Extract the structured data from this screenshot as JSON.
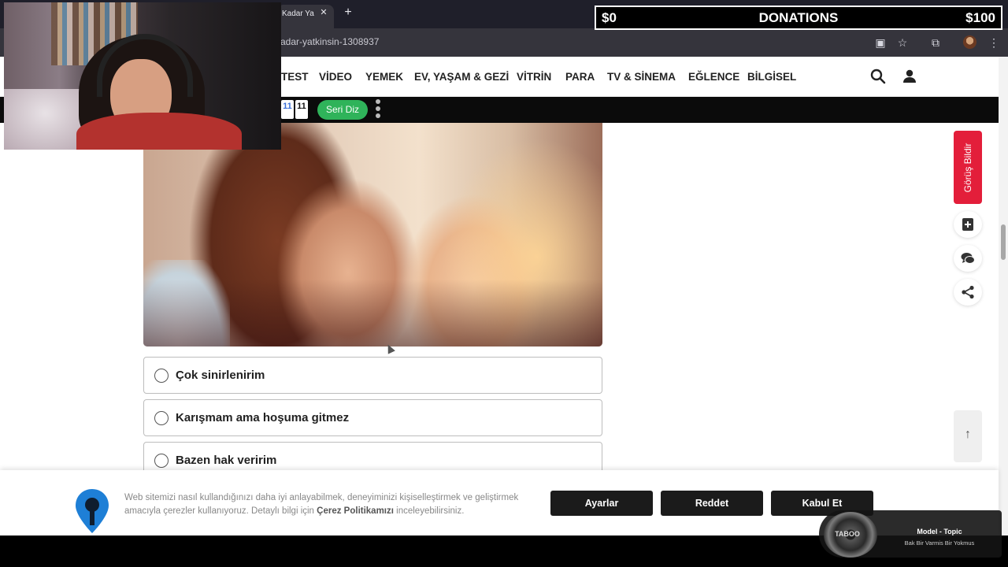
{
  "browser": {
    "tab_title": "Kadar Ya",
    "tab_close": "✕",
    "new_tab": "+",
    "url": "kadar-yatkinsin-1308937"
  },
  "donations": {
    "left": "$0",
    "center": "DONATIONS",
    "right": "$100"
  },
  "nav": {
    "items": [
      "TEST",
      "VİDEO",
      "YEMEK",
      "EV, YAŞAM & GEZİ",
      "VİTRİN",
      "PARA",
      "TV & SİNEMA",
      "EĞLENCE",
      "BİLGİSEL"
    ]
  },
  "toolbar": {
    "tile_1": "11",
    "tile_2": "11",
    "seri_button": "Seri Diz"
  },
  "options": [
    {
      "label": "Çok sinirlenirim"
    },
    {
      "label": "Karışmam ama hoşuma gitmez"
    },
    {
      "label": "Bazen hak veririm"
    }
  ],
  "side": {
    "feedback": "Görüş Bildir",
    "totop": "↑"
  },
  "cookie": {
    "text_before": "Web sitemizi nasıl kullandığınızı daha iyi anlayabilmek, deneyiminizi kişiselleştirmek ve geliştirmek amacıyla çerezler kullanıyoruz. Detaylı bilgi için ",
    "link": "Çerez Politikamızı",
    "text_after": " inceleyebilirsiniz.",
    "settings": "Ayarlar",
    "reject": "Reddet",
    "accept": "Kabul Et"
  },
  "music": {
    "disc_label": "TABOO",
    "title": "Model - Topic",
    "subtitle": "Bak Bir Varmis Bir Yokmus"
  },
  "colors": {
    "accent_red": "#e31e3a",
    "seri_green": "#2fb35a",
    "button_dark": "#1b1b1b"
  }
}
